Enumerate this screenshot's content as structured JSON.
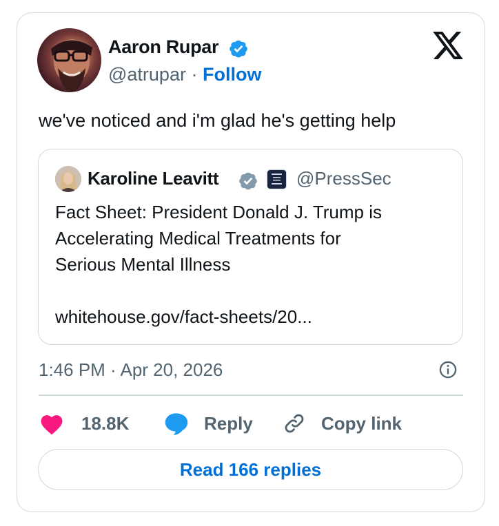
{
  "author": {
    "name": "Aaron Rupar",
    "handle": "@atrupar",
    "separator": "·",
    "follow_label": "Follow"
  },
  "tweet": {
    "text": "we've noticed and i'm glad he's getting help"
  },
  "quoted": {
    "name": "Karoline Leavitt",
    "handle": "@PressSec",
    "body_lines": [
      "Fact Sheet: President Donald J. Trump is",
      "Accelerating Medical Treatments for",
      "Serious Mental Illness"
    ],
    "link": "whitehouse.gov/fact-sheets/20..."
  },
  "timestamp": "1:46 PM · Apr 20, 2026",
  "actions": {
    "like_count": "18.8K",
    "reply_label": "Reply",
    "copy_label": "Copy link"
  },
  "read_replies_label": "Read 166 replies",
  "colors": {
    "accent": "#006fd6",
    "verified": "#1d9bf0",
    "verified_gray": "#829aab",
    "like": "#f91880",
    "reply_icon": "#1d9bf0",
    "muted": "#536471",
    "border": "#cfd9de"
  },
  "icons": {
    "logo": "x-logo-icon",
    "verified": "verified-badge-icon",
    "info": "info-icon",
    "like": "heart-icon",
    "reply": "speech-bubble-icon",
    "copy": "link-icon"
  }
}
